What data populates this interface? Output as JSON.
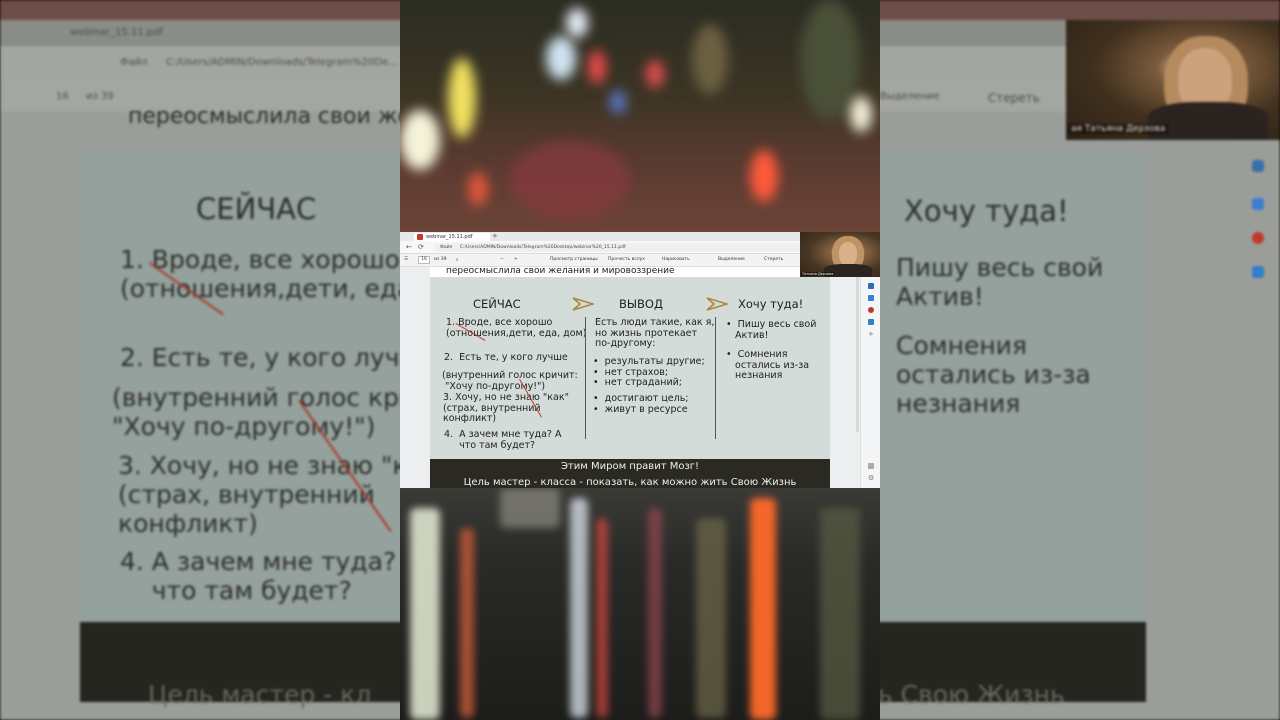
{
  "background": {
    "tab_title": "webinar_15.11.pdf",
    "address_prefix": "Файл",
    "address_path": "C:/Users/ADMIN/Downloads/Telegram%20De...",
    "page_current": "16",
    "page_total": "из 39",
    "tool_highlight": "Выделение",
    "tool_erase": "Стереть",
    "slide_top_line": "переосмыслила свои желания и мировоззрение",
    "col_now_heading": "СЕЙЧАС",
    "col_now_lines": "1. Вроде, все хорошо\n(отношения,дети, еда",
    "col_now_lines2": "2. Есть те, у кого лучш",
    "col_now_lines3": "(внутренний голос кри\n\"Хочу по-другому!\")",
    "col_now_lines4": "3. Хочу, но не знаю \"ка\n(страх, внутренний\nконфликт)",
    "col_now_lines5": "4. А зачем мне туда?\n    что там будет?",
    "col_want_heading": "Хочу туда!",
    "col_want_lines": "Пишу весь свой\nАктив!",
    "col_want_lines2": "Сомнения\nостались из-за\nнезнания",
    "footer_text": "Цель мастер - кл",
    "footer_text_right": "ь Свою Жизнь",
    "camera_name": "ая Татьяна Дерзова"
  },
  "screen": {
    "tab_title": "webinar_15.11.pdf",
    "new_tab": "+",
    "address_prefix": "Файл",
    "address_path": "C:/Users/ADMIN/Downloads/Telegram%20Desktop/webinar%20_15.11.pdf",
    "tools": {
      "page_current": "16",
      "page_total": "из 39",
      "view_pages": "Просмотр страницы",
      "read_aloud": "Прочесть вслух",
      "draw": "Нарисовать",
      "highlight": "Выделение",
      "erase": "Стереть"
    },
    "camera_name": "Татьяна Дерзова",
    "slide": {
      "top_line": "переосмыслила свои желания и мировоззрение",
      "heading_now": "СЕЙЧАС",
      "heading_conclusion": "ВЫВОД",
      "heading_want": "Хочу туда!",
      "now_1": "1. Вроде, все хорошо\n(отношения,дети, еда, дом)",
      "now_2": "2.  Есть те, у кого лучше",
      "now_3": "(внутренний голос кричит:\n \"Хочу по-другому!\")",
      "now_4": "3. Хочу, но не знаю \"как\"\n(страх, внутренний\nконфликт)",
      "now_5": "4.  А зачем мне туда? А\n     что там будет?",
      "conclusion_1": "Есть люди такие, как я,\nно жизнь протекает\nпо-другому:",
      "conclusion_2": "•  результаты другие;\n•  нет страхов;\n•  нет страданий;",
      "conclusion_3": "•  достигают цель;\n•  живут в ресурсе",
      "want_1": "•  Пишу весь свой\n   Актив!",
      "want_2": "•  Сомнения\n   остались из-за\n   незнания",
      "band_line_1": "Этим Миром правит Мозг!",
      "band_line_2": "Цель мастер - класса - показать, как можно жить Свою Жизнь"
    }
  }
}
